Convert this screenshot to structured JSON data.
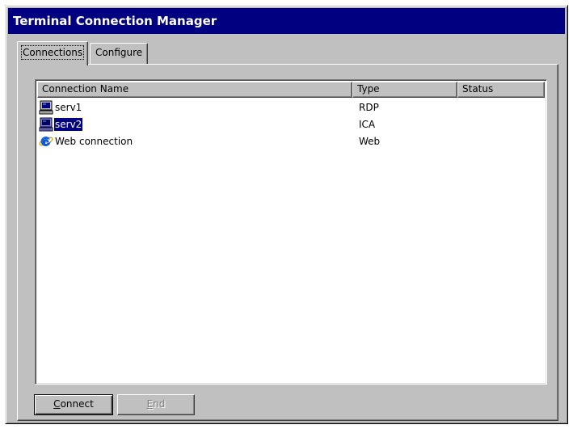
{
  "window": {
    "title": "Terminal Connection Manager"
  },
  "tabs": [
    {
      "label": "Connections",
      "active": true
    },
    {
      "label": "Configure",
      "active": false
    }
  ],
  "list": {
    "columns": [
      "Connection Name",
      "Type",
      "Status"
    ],
    "rows": [
      {
        "name": "serv1",
        "type": "RDP",
        "status": "",
        "icon": "computer-icon",
        "selected": false
      },
      {
        "name": "serv2",
        "type": "ICA",
        "status": "",
        "icon": "computer-icon",
        "selected": true
      },
      {
        "name": "Web connection",
        "type": "Web",
        "status": "",
        "icon": "internet-explorer-icon",
        "selected": false
      }
    ]
  },
  "buttons": {
    "connect_label": "Connect",
    "end_label": "End",
    "end_enabled": false
  },
  "colors": {
    "titlebar": "#000080",
    "face": "#c0c0c0",
    "selection": "#000080"
  }
}
